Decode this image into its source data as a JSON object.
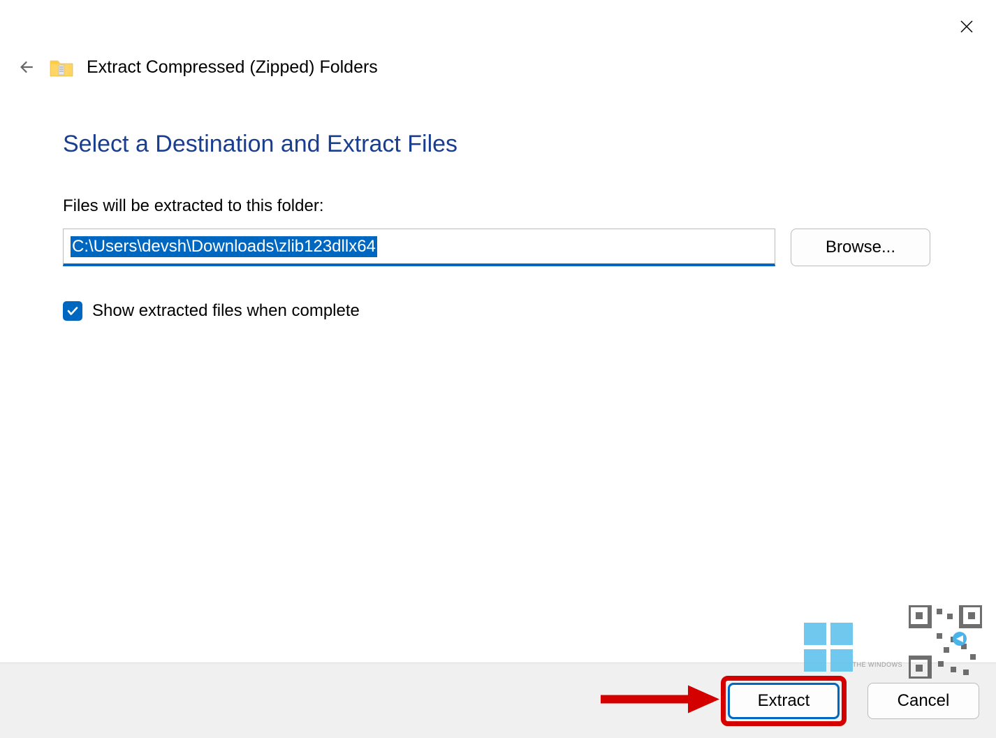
{
  "header": {
    "dialog_title": "Extract Compressed (Zipped) Folders"
  },
  "main": {
    "heading": "Select a Destination and Extract Files",
    "field_label": "Files will be extracted to this folder:",
    "path_value": "C:\\Users\\devsh\\Downloads\\zlib123dllx64",
    "browse_label": "Browse...",
    "checkbox_label": "Show extracted files when complete",
    "checkbox_checked": true
  },
  "footer": {
    "extract_label": "Extract",
    "cancel_label": "Cancel"
  },
  "watermark": {
    "text": "THE WINDOWS"
  }
}
